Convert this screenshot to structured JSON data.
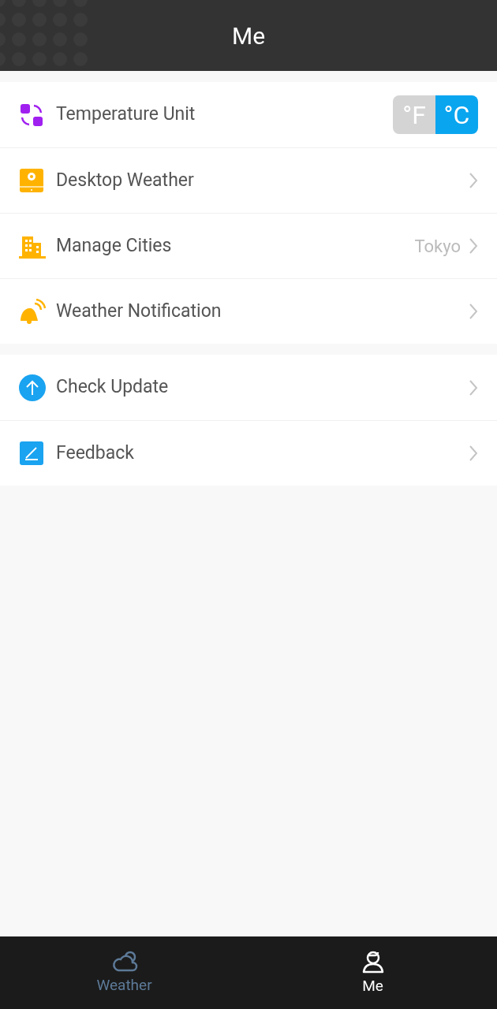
{
  "header": {
    "title": "Me"
  },
  "sections": [
    {
      "items": [
        {
          "kind": "toggle",
          "label": "Temperature Unit",
          "options": [
            {
              "label": "°F",
              "selected": false
            },
            {
              "label": "°C",
              "selected": true
            }
          ]
        },
        {
          "kind": "link",
          "label": "Desktop Weather"
        },
        {
          "kind": "link",
          "label": "Manage Cities",
          "value": "Tokyo"
        },
        {
          "kind": "link",
          "label": "Weather Notification"
        }
      ]
    },
    {
      "items": [
        {
          "kind": "link",
          "label": "Check Update"
        },
        {
          "kind": "link",
          "label": "Feedback"
        }
      ]
    }
  ],
  "tabs": [
    {
      "label": "Weather",
      "selected": false
    },
    {
      "label": "Me",
      "selected": true
    }
  ]
}
